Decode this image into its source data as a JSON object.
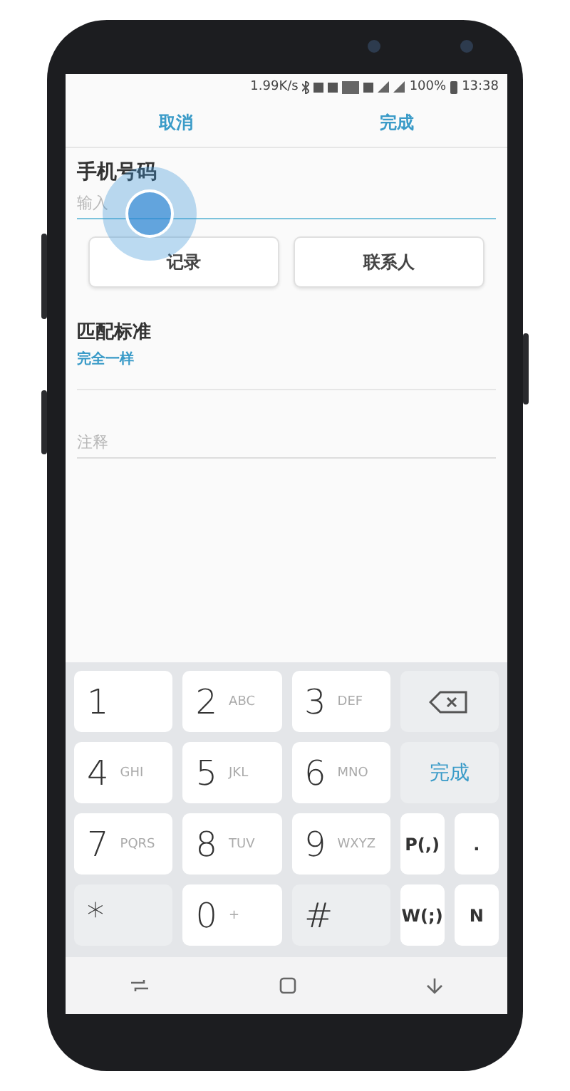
{
  "status_bar": {
    "speed": "1.99K/s",
    "battery": "100%",
    "time": "13:38"
  },
  "header": {
    "cancel": "取消",
    "done": "完成"
  },
  "phone_field": {
    "label": "手机号码",
    "placeholder": "输入"
  },
  "buttons": [
    "记录",
    "联系人"
  ],
  "match": {
    "label": "匹配标准",
    "value": "完全一样"
  },
  "note": {
    "placeholder": "注释"
  },
  "keypad": [
    [
      {
        "kind": "digit",
        "main": "1"
      },
      {
        "kind": "digit",
        "main": "2",
        "sub": "ABC"
      },
      {
        "kind": "digit",
        "main": "3",
        "sub": "DEF"
      },
      {
        "kind": "backspace"
      }
    ],
    [
      {
        "kind": "digit",
        "main": "4",
        "sub": "GHI"
      },
      {
        "kind": "digit",
        "main": "5",
        "sub": "JKL"
      },
      {
        "kind": "digit",
        "main": "6",
        "sub": "MNO"
      },
      {
        "kind": "done",
        "main": "完成"
      }
    ],
    [
      {
        "kind": "digit",
        "main": "7",
        "sub": "PQRS"
      },
      {
        "kind": "digit",
        "main": "8",
        "sub": "TUV"
      },
      {
        "kind": "digit",
        "main": "9",
        "sub": "WXYZ"
      },
      {
        "kind": "small",
        "main": "P(,)"
      },
      {
        "kind": "small",
        "main": "."
      }
    ],
    [
      {
        "kind": "symbol",
        "main": "*"
      },
      {
        "kind": "digit",
        "main": "0",
        "sub": "+"
      },
      {
        "kind": "symbol",
        "main": "#"
      },
      {
        "kind": "small",
        "main": "W(;)"
      },
      {
        "kind": "small",
        "main": "N"
      }
    ]
  ]
}
